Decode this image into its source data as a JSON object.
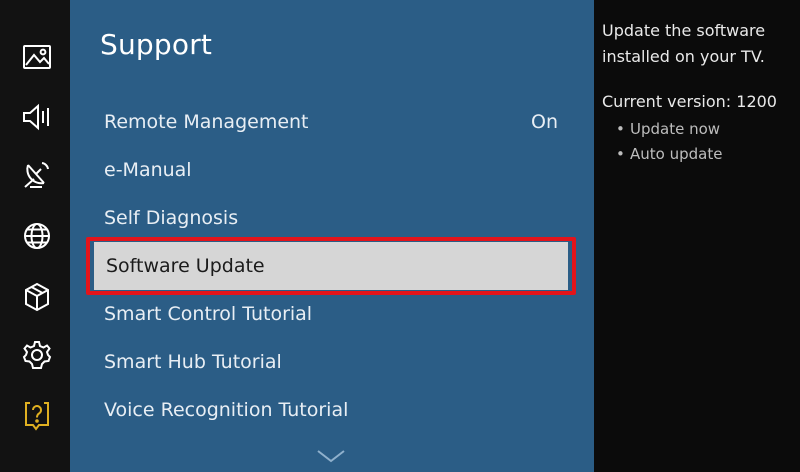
{
  "sidebar": {
    "icons": [
      {
        "name": "picture-icon"
      },
      {
        "name": "sound-icon"
      },
      {
        "name": "broadcast-icon"
      },
      {
        "name": "network-icon"
      },
      {
        "name": "system-icon"
      },
      {
        "name": "settings-icon"
      },
      {
        "name": "support-icon",
        "active": true
      }
    ],
    "active_color": "#e0b021"
  },
  "support": {
    "title": "Support",
    "items": [
      {
        "label": "Remote Management",
        "value": "On"
      },
      {
        "label": "e-Manual"
      },
      {
        "label": "Self Diagnosis"
      },
      {
        "label": "Software Update",
        "selected": true
      },
      {
        "label": "Smart Control Tutorial"
      },
      {
        "label": "Smart Hub Tutorial"
      },
      {
        "label": "Voice Recognition Tutorial"
      }
    ],
    "scroll_icon": "chevron-down-icon",
    "panel_color": "#2b5d86",
    "highlight_color": "#e3141b"
  },
  "help": {
    "description": "Update the software installed on your TV.",
    "version": "Current version: 1200",
    "options": [
      "Update now",
      "Auto update"
    ]
  }
}
